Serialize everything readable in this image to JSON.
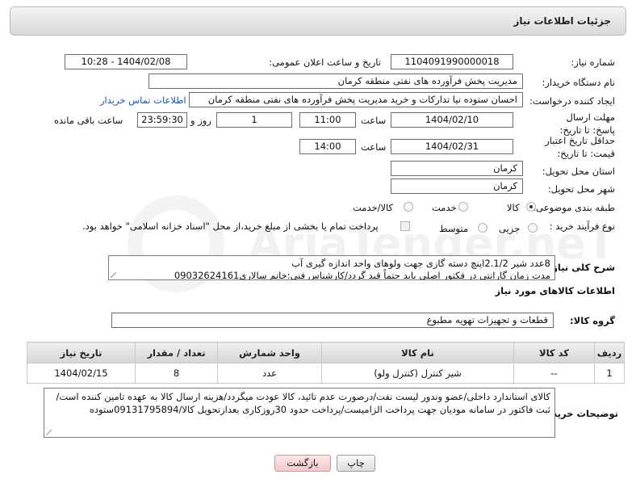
{
  "header": {
    "title": "جزئیات اطلاعات نیاز"
  },
  "need_number": {
    "label": "شماره نیاز:",
    "value": "1104091990000018"
  },
  "announce": {
    "label": "تاریخ و ساعت اعلان عمومی:",
    "value": "1404/02/08 - 10:28"
  },
  "buyer": {
    "label": "نام دستگاه خریدار:",
    "value": "مدیریت پخش فرآورده های نفتی منطقه کرمان"
  },
  "creator": {
    "label": "ایجاد کننده درخواست:",
    "value": "احسان  ستوده نیا  تدارکات و خرید  مدیریت پخش فرآورده های نفتی منطقه کرمان",
    "contact_link": "اطلاعات تماس خریدار"
  },
  "deadline": {
    "label": "مهلت ارسال پاسخ: تا تاریخ:",
    "date": "1404/02/10",
    "time_label": "ساعت",
    "time": "11:00",
    "days": "1",
    "days_label": "روز و",
    "remaining": "23:59:30",
    "remaining_label": "ساعت باقی مانده"
  },
  "validity": {
    "label": "حداقل تاریخ اعتبار قیمت: تا تاریخ:",
    "date": "1404/02/31",
    "time_label": "ساعت",
    "time": "14:00"
  },
  "province": {
    "label": "استان محل تحویل:",
    "value": "کرمان"
  },
  "city": {
    "label": "شهر محل تحویل:",
    "value": "کرمان"
  },
  "category": {
    "label": "طبقه بندی موضوعی:",
    "options": [
      "کالا",
      "خدمت",
      "کالا/خدمت"
    ],
    "selected": 0
  },
  "process": {
    "label": "نوع فرآیند خرید :",
    "options": [
      "جزیی",
      "متوسط"
    ],
    "note": "پرداخت تمام یا بخشی از مبلغ خرید،از محل \"اسناد خزانه اسلامی\" خواهد بود."
  },
  "description": {
    "label": "شرح کلی نیاز:",
    "line1": "8عدد شیر 2.1/2اینچ دسته گازی جهت ولوهای واحد اندازه گیری آب",
    "line2": "مدت زمان گارانتی در فکتور اصلی باید حتماً قید گردد/کارشناس فنی:خانم سالاری09032624161"
  },
  "goods_info": {
    "title": "اطلاعات کالاهای مورد نیاز"
  },
  "goods_group": {
    "label": "گروه کالا:",
    "value": "قطعات و تجهیزات تهویه مطبوع"
  },
  "table": {
    "headers": [
      "ردیف",
      "کد کالا",
      "نام کالا",
      "واحد شمارش",
      "تعداد / مقدار",
      "تاریخ نیاز"
    ],
    "rows": [
      [
        "1",
        "--",
        "شیر کنترل (کنترل ولو)",
        "عدد",
        "8",
        "1404/02/15"
      ]
    ]
  },
  "buyer_notes": {
    "label": "توضیحات خریدار:",
    "text": "کالای استاندارد داخلی/عضو وندور لیست نفت/درصورت عدم تائید، کالا عودت میگردد/هزینه ارسال کالا به عهده تامین کننده است/ثبت فاکتور در سامانه مودیان جهت پرداخت الزامیست/پرداخت حدود 30روزکاری بعدازتحویل کالا/09131795894ستوده"
  },
  "buttons": {
    "print": "چاپ",
    "back": "بازگشت"
  },
  "watermark": "AriaTender.neT"
}
